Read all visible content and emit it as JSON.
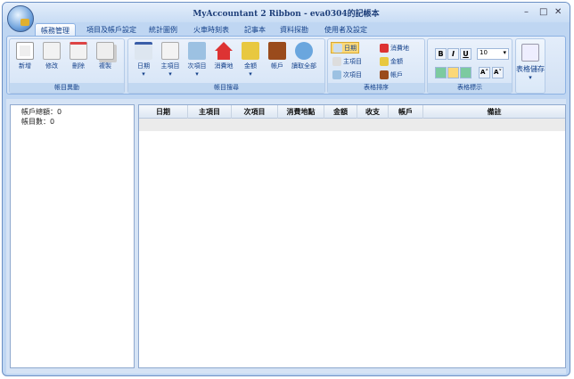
{
  "window": {
    "title": "MyAccountant 2 Ribbon - eva0304的記帳本",
    "minimize": "–",
    "maximize": "□",
    "close": "✕"
  },
  "tabs": [
    "帳務管理",
    "項目及帳戶設定",
    "統計圖例",
    "火車時刻表",
    "記事本",
    "資料探勘",
    "使用者及設定"
  ],
  "groups": {
    "edit": {
      "label": "帳目異動",
      "buttons": [
        "新增",
        "修改",
        "刪除",
        "複製"
      ]
    },
    "search": {
      "label": "帳目搜尋",
      "buttons": [
        "日期",
        "主項目",
        "次項目",
        "消費地",
        "金額",
        "帳戶",
        "讀取全部"
      ]
    },
    "sort": {
      "label": "表格排序",
      "items": [
        "日期",
        "主項目",
        "次項目",
        "消費地",
        "金額",
        "帳戶"
      ]
    },
    "format": {
      "label": "表格標示",
      "bold": "B",
      "italic": "I",
      "underline": "U",
      "font_size": "10",
      "grow": "A˄",
      "shrink": "A˅"
    },
    "save": {
      "label": "表格儲存"
    }
  },
  "summary": {
    "total": "帳戶總額：0",
    "count": "帳目數：0"
  },
  "table": {
    "columns": [
      "日期",
      "主項目",
      "次項目",
      "消費地點",
      "金額",
      "收支",
      "帳戶",
      "備註"
    ]
  }
}
